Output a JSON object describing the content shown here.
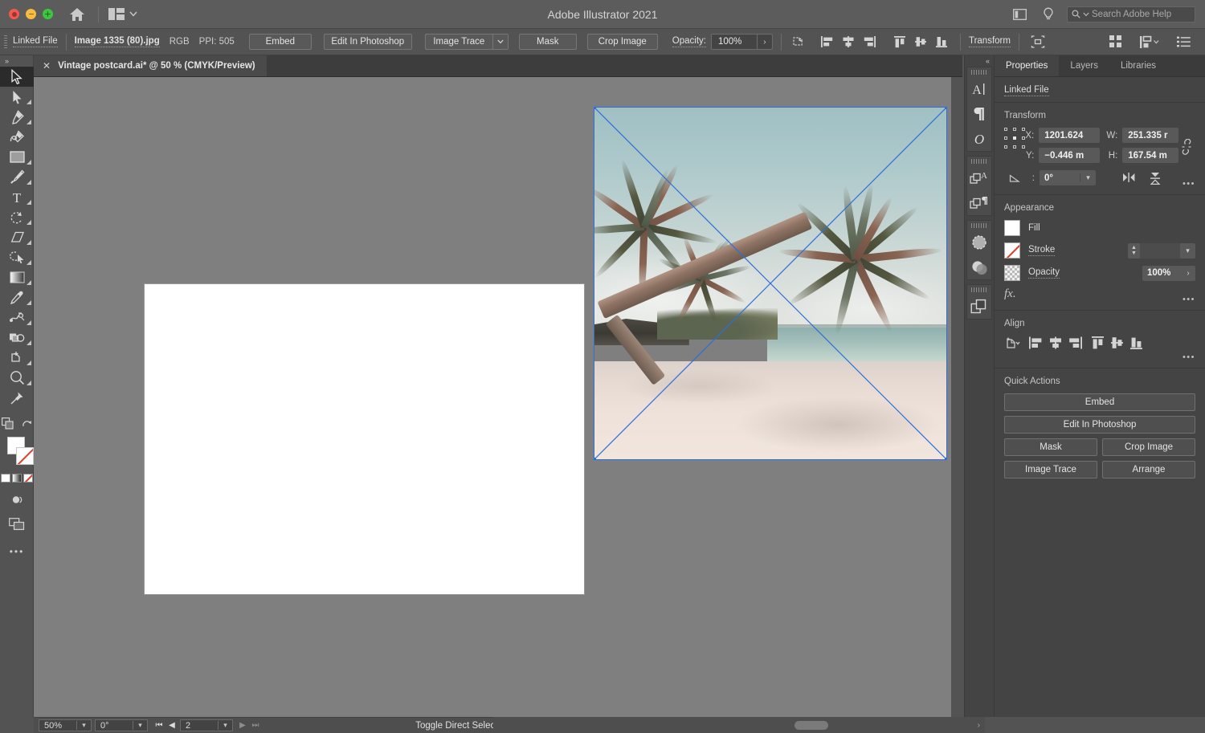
{
  "window": {
    "title": "Adobe Illustrator 2021",
    "traffic_lights": [
      "close",
      "minimize",
      "maximize"
    ],
    "home_icon": "home-icon",
    "arrange_icon": "arrange-documents-icon",
    "workspace_icon": "workspace-switcher-icon",
    "help_icon": "discover-bulb-icon",
    "search": {
      "placeholder": "Search Adobe Help",
      "icon": "search-icon"
    }
  },
  "control_bar": {
    "selection_label": "Linked File",
    "file_name": "Image 1335 (80).jpg",
    "color_mode": "RGB",
    "ppi": "PPI: 505",
    "embed_label": "Embed",
    "edit_in_photoshop_label": "Edit In Photoshop",
    "image_trace_label": "Image Trace",
    "mask_label": "Mask",
    "crop_image_label": "Crop Image",
    "opacity_label": "Opacity:",
    "opacity_value": "100%",
    "transform_label": "Transform",
    "icons": [
      "select-similar-objects-icon",
      "align-left-icon",
      "align-horizontal-center-icon",
      "align-right-icon",
      "align-top-icon",
      "align-vertical-center-icon",
      "align-bottom-icon",
      "isolate-selected-icon",
      "arrange-documents-grid-icon",
      "workspace-switcher-icon",
      "properties-menu-icon"
    ]
  },
  "toolbar": {
    "expand_icon": "expand-toolbar-icon",
    "tools": [
      {
        "name": "selection-tool",
        "glyph": "arrow",
        "active": true,
        "has_flyout": false
      },
      {
        "name": "direct-selection-tool",
        "glyph": "arrow-solid",
        "active": false,
        "has_flyout": true
      },
      {
        "name": "pen-tool",
        "glyph": "pen",
        "active": false,
        "has_flyout": true
      },
      {
        "name": "curvature-tool",
        "glyph": "curvature",
        "active": false,
        "has_flyout": false
      },
      {
        "name": "rectangle-tool",
        "glyph": "rectangle",
        "active": false,
        "has_flyout": true
      },
      {
        "name": "paintbrush-tool",
        "glyph": "brush",
        "active": false,
        "has_flyout": true
      },
      {
        "name": "type-tool",
        "glyph": "type",
        "active": false,
        "has_flyout": true
      },
      {
        "name": "rotate-tool",
        "glyph": "rotate",
        "active": false,
        "has_flyout": true
      },
      {
        "name": "eraser-tool",
        "glyph": "eraser",
        "active": false,
        "has_flyout": true
      },
      {
        "name": "shaper-tool",
        "glyph": "shaper",
        "active": false,
        "has_flyout": true
      },
      {
        "name": "gradient-tool",
        "glyph": "gradient",
        "active": false,
        "has_flyout": true
      },
      {
        "name": "eyedropper-tool",
        "glyph": "eyedropper",
        "active": false,
        "has_flyout": true
      },
      {
        "name": "blend-tool",
        "glyph": "blend",
        "active": false,
        "has_flyout": true
      },
      {
        "name": "shape-builder-tool",
        "glyph": "shape-builder",
        "active": false,
        "has_flyout": true
      },
      {
        "name": "artboard-tool",
        "glyph": "artboard",
        "active": false,
        "has_flyout": true
      },
      {
        "name": "zoom-tool",
        "glyph": "zoom",
        "active": false,
        "has_flyout": true
      },
      {
        "name": "pin-tool",
        "glyph": "pin",
        "active": false,
        "has_flyout": false
      }
    ],
    "swap_icon": "swap-fill-stroke-icon",
    "default_icon": "default-fill-stroke-icon",
    "fill_color": "#ffffff",
    "stroke_color": "none",
    "mini_modes": [
      "color-mode-icon",
      "gradient-mode-icon",
      "none-mode-icon"
    ],
    "draw_mode_icon": "draw-normal-icon",
    "screen_mode_icon": "change-screen-mode-icon"
  },
  "document_tab": {
    "close_icon": "close-tab-icon",
    "label": "Vintage postcard.ai* @ 50 % (CMYK/Preview)"
  },
  "canvas": {
    "artboard_background": "#ffffff",
    "canvas_background": "#7f7f7f",
    "selection_color": "#2f6fd9",
    "placed_image": {
      "name": "Image 1335 (80).jpg",
      "description": "Vintage-toned beach photo with leaning palm trees, white sand and turquoise sea",
      "selected": true,
      "linked": true
    }
  },
  "status_bar": {
    "zoom_value": "50%",
    "rotate_value": "0°",
    "artboard_value": "2",
    "first_icon": "first-artboard-icon",
    "prev_icon": "previous-artboard-icon",
    "next_icon": "next-artboard-icon",
    "last_icon": "last-artboard-icon",
    "message": "Toggle Direct Selection"
  },
  "dock_rail": {
    "collapse_icon": "collapse-panels-icon",
    "groups": [
      [
        "character-panel-icon",
        "paragraph-panel-icon",
        "opentype-panel-icon"
      ],
      [
        "character-styles-panel-icon",
        "paragraph-styles-panel-icon"
      ],
      [
        "brushes-panel-icon",
        "transparency-panel-icon"
      ],
      [
        "layers-panel-icon"
      ]
    ]
  },
  "properties_panel": {
    "tabs": [
      {
        "label": "Properties",
        "active": true
      },
      {
        "label": "Layers",
        "active": false
      },
      {
        "label": "Libraries",
        "active": false
      }
    ],
    "selection_state": "Linked File",
    "transform": {
      "title": "Transform",
      "x_label": "X:",
      "x_value": "1201.624",
      "y_label": "Y:",
      "y_value": "−0.446 m",
      "w_label": "W:",
      "w_value": "251.335 r",
      "h_label": "H:",
      "h_value": "167.54 m",
      "angle_label": "angle-icon",
      "angle_value": "0°",
      "link_icon": "unlink-proportions-icon",
      "flip_h_icon": "flip-horizontal-icon",
      "flip_v_icon": "flip-vertical-icon",
      "more_icon": "more-options-icon"
    },
    "appearance": {
      "title": "Appearance",
      "fill_label": "Fill",
      "fill_color": "#ffffff",
      "stroke_label": "Stroke",
      "stroke_color": "none",
      "stroke_weight": "",
      "opacity_label": "Opacity",
      "opacity_value": "100%",
      "fx_label": "fx.",
      "more_icon": "more-options-icon"
    },
    "align": {
      "title": "Align",
      "icons": [
        "align-to-selection-icon",
        "align-left-icon",
        "align-horizontal-center-icon",
        "align-right-icon",
        "align-top-icon",
        "align-vertical-center-icon",
        "align-bottom-icon"
      ],
      "more_icon": "more-options-icon"
    },
    "quick_actions": {
      "title": "Quick Actions",
      "buttons": [
        "Embed",
        "Edit In Photoshop",
        "Mask",
        "Crop Image",
        "Image Trace",
        "Arrange"
      ]
    }
  }
}
